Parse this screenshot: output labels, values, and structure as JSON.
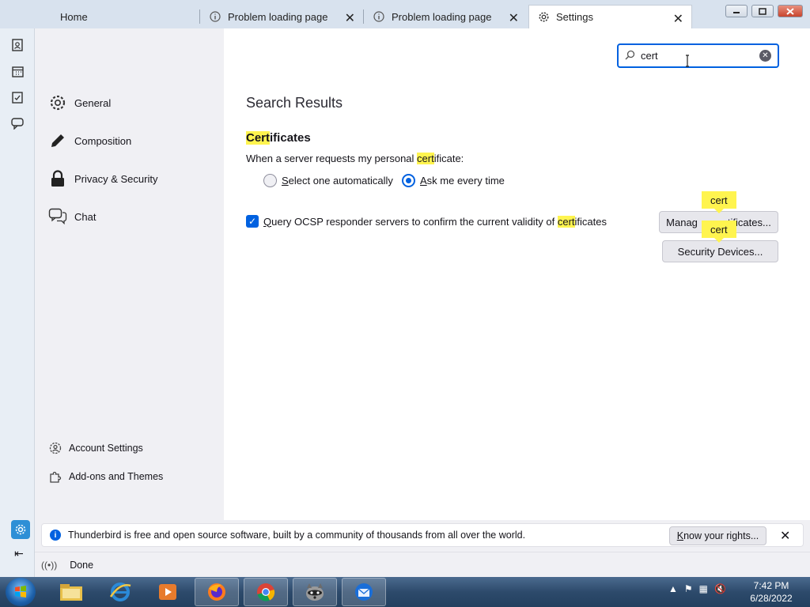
{
  "tabs": [
    {
      "label": "Home"
    },
    {
      "label": "Problem loading page"
    },
    {
      "label": "Problem loading page"
    },
    {
      "label": "Settings"
    }
  ],
  "sidebar": {
    "items": [
      {
        "label": "General",
        "icon": "gear-icon"
      },
      {
        "label": "Composition",
        "icon": "pencil-icon"
      },
      {
        "label": "Privacy & Security",
        "icon": "lock-icon"
      },
      {
        "label": "Chat",
        "icon": "chat-icon"
      }
    ],
    "footer": [
      {
        "label": "Account Settings",
        "icon": "account-settings-icon"
      },
      {
        "label": "Add-ons and Themes",
        "icon": "puzzle-icon"
      }
    ]
  },
  "search": {
    "value": "cert"
  },
  "main": {
    "results_title": "Search Results",
    "cert_heading_hl": "Cert",
    "cert_heading_rest": "ificates",
    "request_prefix": "When a server requests my personal ",
    "request_hl": "cert",
    "request_suffix": "ificate:",
    "radio_auto_mnemonic": "S",
    "radio_auto_rest": "elect one automatically",
    "radio_ask_mnemonic": "A",
    "radio_ask_rest": "sk me every time",
    "ocsp_mnemonic": "Q",
    "ocsp_prefix": "uery OCSP responder servers to confirm the current validity of ",
    "ocsp_hl": "cert",
    "ocsp_suffix": "ificates",
    "manage_btn_left": "Manag",
    "manage_btn_right": "tificates...",
    "manage_bubble": "cert",
    "devices_btn_label": "Security Devices...",
    "devices_bubble": "cert"
  },
  "notification": {
    "text": "Thunderbird is free and open source software, built by a community of thousands from all over the world.",
    "button": "Know your rights...",
    "button_mnemonic": "K",
    "button_rest": "now your rights..."
  },
  "status": {
    "text": "Done"
  },
  "taskbar": {
    "time": "7:42 PM",
    "date": "6/28/2022"
  },
  "colors": {
    "accent": "#0061e0",
    "highlight": "#fff44f"
  }
}
